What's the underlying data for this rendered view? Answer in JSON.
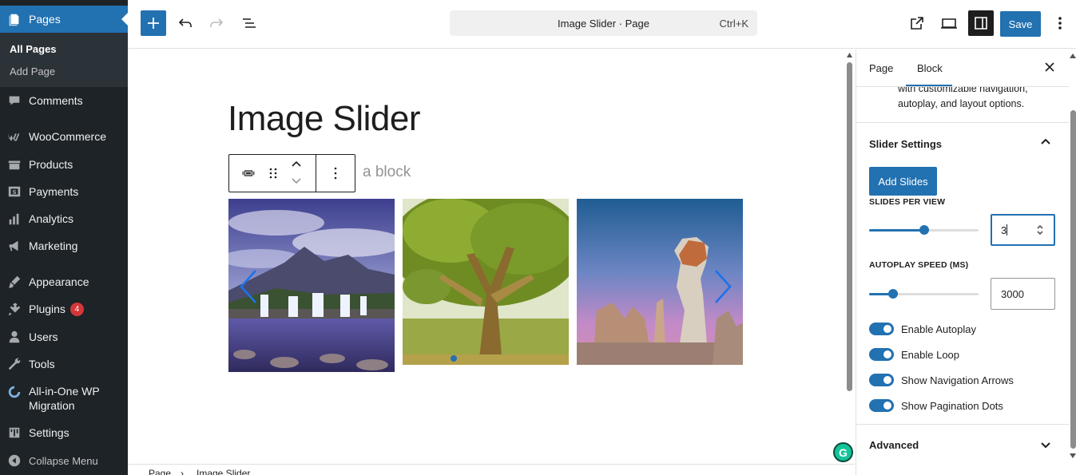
{
  "admin_menu": {
    "pages": "Pages",
    "all_pages": "All Pages",
    "add_page": "Add Page",
    "comments": "Comments",
    "woocommerce": "WooCommerce",
    "products": "Products",
    "payments": "Payments",
    "analytics": "Analytics",
    "marketing": "Marketing",
    "appearance": "Appearance",
    "plugins": "Plugins",
    "plugins_badge": "4",
    "users": "Users",
    "tools": "Tools",
    "migration_line1": "All-in-One WP",
    "migration_line2": "Migration",
    "settings": "Settings",
    "collapse": "Collapse Menu"
  },
  "toolbar": {
    "document_title": "Image Slider · Page",
    "shortcut": "Ctrl+K",
    "save_label": "Save"
  },
  "canvas": {
    "page_title": "Image Slider",
    "placeholder_fragment": "a block"
  },
  "slider": {
    "slides": [
      {
        "subject": "waterfall-landscape"
      },
      {
        "subject": "large-tree"
      },
      {
        "subject": "rock-formation"
      }
    ]
  },
  "breadcrumb": {
    "root": "Page",
    "separator": "›",
    "current": "Image Slider"
  },
  "settings_panel": {
    "tabs": [
      "Page",
      "Block"
    ],
    "active_tab": "Block",
    "block_description": "with customizable navigation, autoplay, and layout options.",
    "slider_settings_title": "Slider Settings",
    "add_slides_label": "Add Slides",
    "slides_per_view": {
      "label": "SLIDES PER VIEW",
      "value": "3",
      "slider_fraction": 0.5
    },
    "autoplay_speed": {
      "label": "AUTOPLAY SPEED (MS)",
      "value": "3000",
      "slider_fraction": 0.22
    },
    "toggles": [
      {
        "label": "Enable Autoplay",
        "on": true
      },
      {
        "label": "Enable Loop",
        "on": true
      },
      {
        "label": "Show Navigation Arrows",
        "on": true
      },
      {
        "label": "Show Pagination Dots",
        "on": true
      }
    ],
    "advanced_title": "Advanced"
  },
  "colors": {
    "sidebar_bg": "#1d2327",
    "accent": "#2271b1",
    "badge": "#d63638",
    "arrow": "#1a73e8"
  }
}
